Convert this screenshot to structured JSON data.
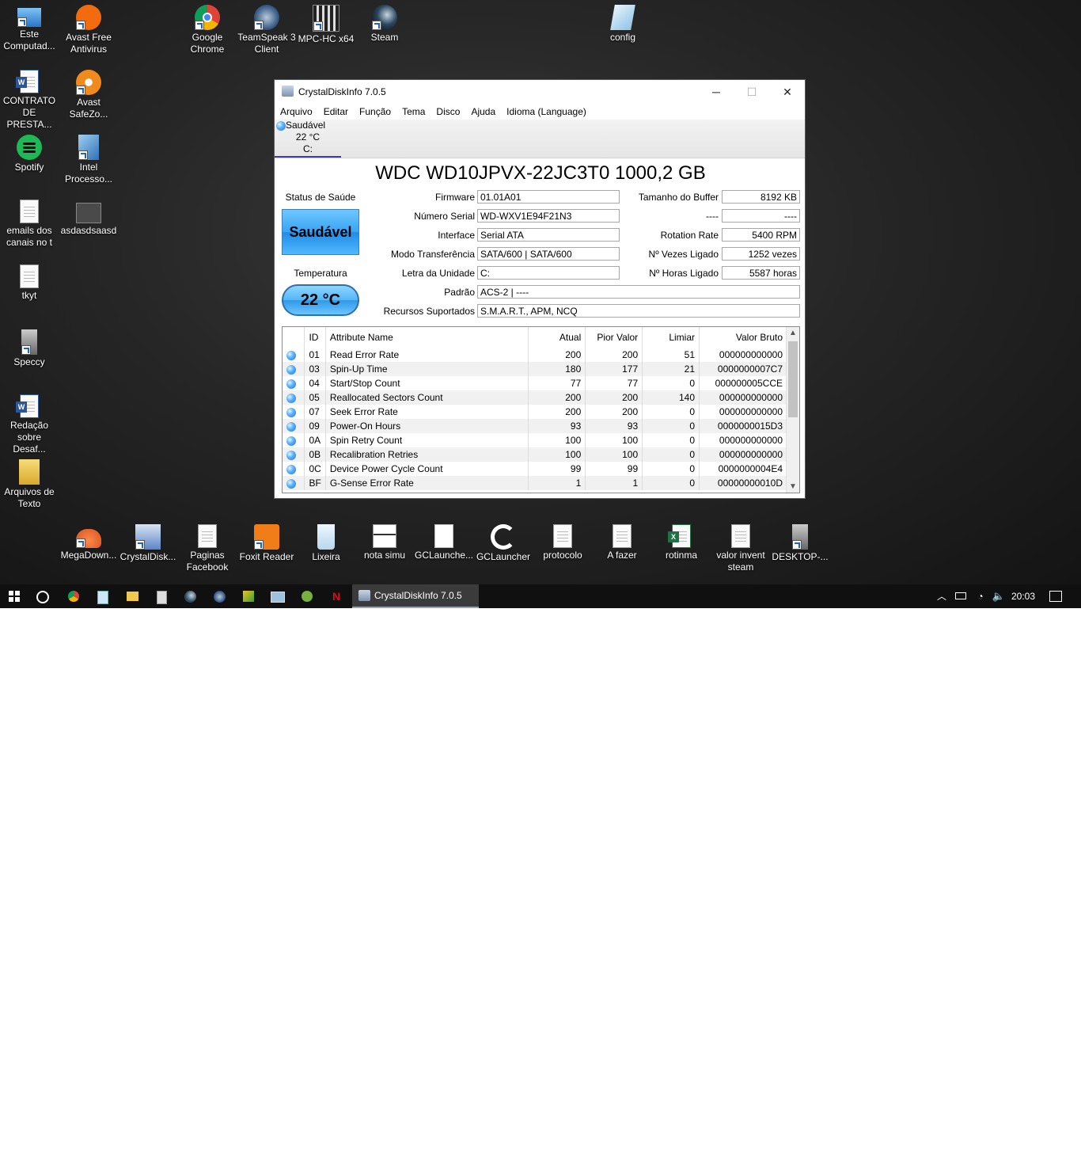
{
  "desktop_icons": [
    {
      "label": "Este Computad...",
      "icon": "computer-icon",
      "color": "#3b8ede"
    },
    {
      "label": "Avast Free Antivirus",
      "icon": "avast-icon",
      "color": "#f26b0f"
    },
    {
      "label": "Google Chrome",
      "icon": "chrome-icon",
      "color": "#db4437"
    },
    {
      "label": "TeamSpeak 3 Client",
      "icon": "teamspeak-icon",
      "color": "#2c4f7a"
    },
    {
      "label": "MPC-HC x64",
      "icon": "mpc-icon",
      "color": "#444444"
    },
    {
      "label": "Steam",
      "icon": "steam-icon",
      "color": "#1b2838"
    },
    {
      "label": "config",
      "icon": "config-icon",
      "color": "#9bc7e6"
    },
    {
      "label": "CONTRATO DE PRESTA...",
      "icon": "word-doc-icon",
      "color": "#2b579a"
    },
    {
      "label": "Avast SafeZo...",
      "icon": "avast-safezone-icon",
      "color": "#f08a1c"
    },
    {
      "label": "Spotify",
      "icon": "spotify-icon",
      "color": "#1db954"
    },
    {
      "label": "Intel Processo...",
      "icon": "intel-icon",
      "color": "#4a8fd8"
    },
    {
      "label": "emails dos canais no t",
      "icon": "text-file-icon",
      "color": "#fafafa"
    },
    {
      "label": "asdasdsaasd",
      "icon": "folder-dark-icon",
      "color": "#555555"
    },
    {
      "label": "tkyt",
      "icon": "text-file-icon",
      "color": "#fafafa"
    },
    {
      "label": "Speccy",
      "icon": "speccy-icon",
      "color": "#777777"
    },
    {
      "label": "Redação sobre Desaf...",
      "icon": "word-doc-icon",
      "color": "#2b579a"
    },
    {
      "label": "Arquivos de Texto",
      "icon": "folder-icon",
      "color": "#e8c24f"
    },
    {
      "label": "MegaDown...",
      "icon": "megadownloader-icon",
      "color": "#f06a2a"
    },
    {
      "label": "CrystalDisk...",
      "icon": "crystaldisk-icon",
      "color": "#5c84c8"
    },
    {
      "label": "Paginas Facebook",
      "icon": "text-file-icon",
      "color": "#fafafa"
    },
    {
      "label": "Foxit Reader",
      "icon": "foxit-icon",
      "color": "#f07d18"
    },
    {
      "label": "Lixeira",
      "icon": "recycle-bin-icon",
      "color": "#cfe6f7"
    },
    {
      "label": "nota simu",
      "icon": "image-file-icon",
      "color": "#ffffff"
    },
    {
      "label": "GCLaunche...",
      "icon": "blank-file-icon",
      "color": "#ffffff"
    },
    {
      "label": "GCLauncher",
      "icon": "gclauncher-icon",
      "color": "#ffffff"
    },
    {
      "label": "protocolo",
      "icon": "text-file-icon",
      "color": "#fafafa"
    },
    {
      "label": "A fazer",
      "icon": "text-file-icon",
      "color": "#fafafa"
    },
    {
      "label": "rotinma",
      "icon": "excel-icon",
      "color": "#1f7244"
    },
    {
      "label": "valor invent steam",
      "icon": "text-file-icon",
      "color": "#fafafa"
    },
    {
      "label": "DESKTOP-...",
      "icon": "server-icon",
      "color": "#777777"
    }
  ],
  "window": {
    "title": "CrystalDiskInfo 7.0.5",
    "controls": {
      "minimize": "─",
      "maximize": "☐",
      "close": "✕"
    },
    "menu": [
      "Arquivo",
      "Editar",
      "Função",
      "Tema",
      "Disco",
      "Ajuda",
      "Idioma (Language)"
    ],
    "drive_tab": {
      "status": "Saudável",
      "temp": "22 °C",
      "letter": "C:"
    },
    "model": "WDC WD10JPVX-22JC3T0 1000,2 GB",
    "health_label": "Status de Saúde",
    "health_value": "Saudável",
    "temp_label": "Temperatura",
    "temp_value": "22 °C",
    "fields": {
      "firmware": {
        "label": "Firmware",
        "value": "01.01A01"
      },
      "serial": {
        "label": "Número Serial",
        "value": "WD-WXV1E94F21N3"
      },
      "interface": {
        "label": "Interface",
        "value": "Serial ATA"
      },
      "transfer": {
        "label": "Modo Transferência",
        "value": "SATA/600 | SATA/600"
      },
      "drive_letter": {
        "label": "Letra da Unidade",
        "value": "C:"
      },
      "standard": {
        "label": "Padrão",
        "value": "ACS-2 | ----"
      },
      "features": {
        "label": "Recursos Suportados",
        "value": "S.M.A.R.T., APM, NCQ"
      },
      "buffer": {
        "label": "Tamanho do Buffer",
        "value": "8192 KB"
      },
      "blank": {
        "label": "----",
        "value": "----"
      },
      "rotation": {
        "label": "Rotation Rate",
        "value": "5400 RPM"
      },
      "power_count": {
        "label": "Nº Vezes Ligado",
        "value": "1252 vezes"
      },
      "power_hours": {
        "label": "Nº Horas Ligado",
        "value": "5587 horas"
      }
    },
    "smart_headers": {
      "id": "ID",
      "name": "Attribute Name",
      "current": "Atual",
      "worst": "Pior Valor",
      "threshold": "Limiar",
      "raw": "Valor Bruto"
    },
    "smart_rows": [
      {
        "id": "01",
        "name": "Read Error Rate",
        "current": "200",
        "worst": "200",
        "threshold": "51",
        "raw": "000000000000"
      },
      {
        "id": "03",
        "name": "Spin-Up Time",
        "current": "180",
        "worst": "177",
        "threshold": "21",
        "raw": "0000000007C7"
      },
      {
        "id": "04",
        "name": "Start/Stop Count",
        "current": "77",
        "worst": "77",
        "threshold": "0",
        "raw": "000000005CCE"
      },
      {
        "id": "05",
        "name": "Reallocated Sectors Count",
        "current": "200",
        "worst": "200",
        "threshold": "140",
        "raw": "000000000000"
      },
      {
        "id": "07",
        "name": "Seek Error Rate",
        "current": "200",
        "worst": "200",
        "threshold": "0",
        "raw": "000000000000"
      },
      {
        "id": "09",
        "name": "Power-On Hours",
        "current": "93",
        "worst": "93",
        "threshold": "0",
        "raw": "0000000015D3"
      },
      {
        "id": "0A",
        "name": "Spin Retry Count",
        "current": "100",
        "worst": "100",
        "threshold": "0",
        "raw": "000000000000"
      },
      {
        "id": "0B",
        "name": "Recalibration Retries",
        "current": "100",
        "worst": "100",
        "threshold": "0",
        "raw": "000000000000"
      },
      {
        "id": "0C",
        "name": "Device Power Cycle Count",
        "current": "99",
        "worst": "99",
        "threshold": "0",
        "raw": "0000000004E4"
      },
      {
        "id": "BF",
        "name": "G-Sense Error Rate",
        "current": "1",
        "worst": "1",
        "threshold": "0",
        "raw": "00000000010D"
      }
    ]
  },
  "taskbar": {
    "pinned": [
      "windows-start-icon",
      "cortana-icon",
      "chrome-icon",
      "notepad-icon",
      "file-explorer-icon",
      "calculator-icon",
      "steam-icon",
      "teamspeak-icon",
      "photo-app-icon",
      "remote-desktop-icon",
      "utorrent-icon",
      "netflix-icon"
    ],
    "active_app": "CrystalDiskInfo 7.0.5",
    "tray": [
      "chevron-up-icon",
      "battery-icon",
      "wifi-icon",
      "volume-icon"
    ],
    "time": "20:03",
    "notification": "action-center-icon"
  }
}
